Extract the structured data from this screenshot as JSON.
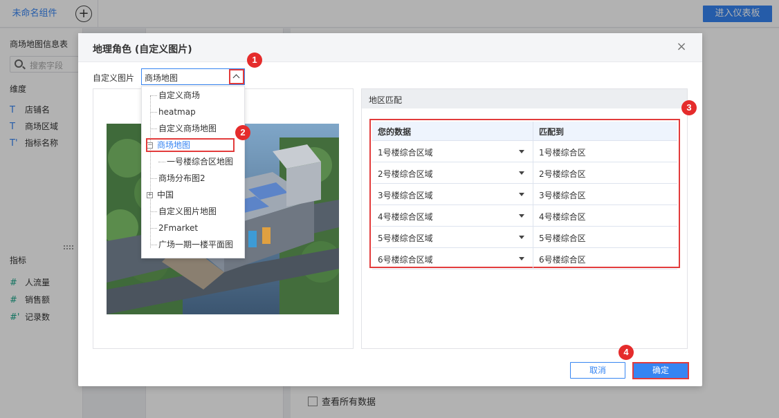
{
  "app": {
    "component_tab": "未命名组件",
    "add_symbol": "+",
    "enter_dashboard": "进入仪表板"
  },
  "left_panel": {
    "dataset_title": "商场地图信息表",
    "search_placeholder": "搜索字段",
    "dimension_label": "维度",
    "dimensions": [
      {
        "icon": "T",
        "label": "店铺名"
      },
      {
        "icon": "T",
        "label": "商场区域"
      },
      {
        "icon": "T'",
        "label": "指标名称"
      }
    ],
    "measure_label": "指标",
    "measures": [
      {
        "icon": "#",
        "label": "人流量"
      },
      {
        "icon": "#",
        "label": "销售额"
      },
      {
        "icon": "#'",
        "label": "记录数"
      }
    ]
  },
  "bottom": {
    "view_all_label": "查看所有数据"
  },
  "dialog": {
    "title": "地理角色 (自定义图片)",
    "close_symbol": "×",
    "picture_label": "自定义图片",
    "selected_picture": "商场地图",
    "tree": [
      {
        "label": "自定义商场"
      },
      {
        "label": "heatmap"
      },
      {
        "label": "自定义商场地图"
      },
      {
        "label": "商场地图",
        "expander": "−",
        "selected": true
      },
      {
        "label": "一号楼综合区地图",
        "child": true
      },
      {
        "label": "商场分布图2"
      },
      {
        "label": "中国",
        "expander": "+"
      },
      {
        "label": "自定义图片地图"
      },
      {
        "label": "2Fmarket"
      },
      {
        "label": "广场一期一楼平面图"
      }
    ],
    "match_title": "地区匹配",
    "match_headers": {
      "your_data": "您的数据",
      "match_to": "匹配到"
    },
    "match_rows": [
      {
        "your_data": "1号楼综合区域",
        "match_to": "1号楼综合区"
      },
      {
        "your_data": "2号楼综合区域",
        "match_to": "2号楼综合区"
      },
      {
        "your_data": "3号楼综合区域",
        "match_to": "3号楼综合区"
      },
      {
        "your_data": "4号楼综合区域",
        "match_to": "4号楼综合区"
      },
      {
        "your_data": "5号楼综合区域",
        "match_to": "5号楼综合区"
      },
      {
        "your_data": "6号楼综合区域",
        "match_to": "6号楼综合区"
      }
    ],
    "cancel_label": "取消",
    "ok_label": "确定"
  },
  "markers": [
    "1",
    "2",
    "3",
    "4"
  ],
  "colors": {
    "accent": "#3685f2",
    "annotation_red": "#e23b3b",
    "overlay": "rgba(0,0,0,0.30)"
  }
}
